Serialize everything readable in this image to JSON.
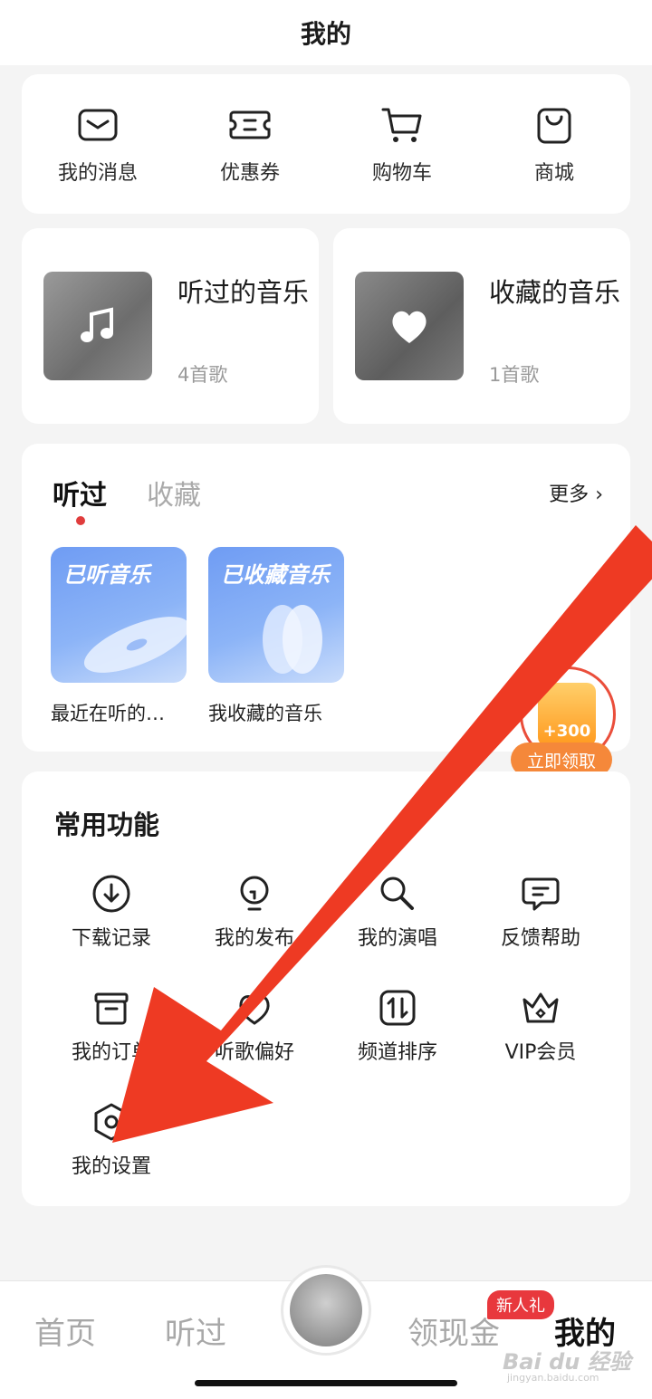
{
  "header": {
    "title": "我的"
  },
  "quick": [
    {
      "label": "我的消息",
      "icon": "message-icon"
    },
    {
      "label": "优惠券",
      "icon": "coupon-icon"
    },
    {
      "label": "购物车",
      "icon": "cart-icon"
    },
    {
      "label": "商城",
      "icon": "shopping-bag-icon"
    }
  ],
  "music_cards": {
    "listened": {
      "title": "听过的音乐",
      "count": "4首歌",
      "icon": "music-note-icon"
    },
    "collected": {
      "title": "收藏的音乐",
      "count": "1首歌",
      "icon": "heart-icon"
    }
  },
  "history": {
    "tabs": {
      "active": "听过",
      "inactive": "收藏"
    },
    "more": "更多",
    "tiles": [
      {
        "cover_text": "已听音乐",
        "label": "最近在听的…"
      },
      {
        "cover_text": "已收藏音乐",
        "label": "我收藏的音乐"
      }
    ]
  },
  "reward": {
    "amount": "+300",
    "button": "立即领取"
  },
  "functions": {
    "title": "常用功能",
    "items": [
      {
        "label": "下载记录",
        "icon": "download-icon"
      },
      {
        "label": "我的发布",
        "icon": "lightbulb-icon"
      },
      {
        "label": "我的演唱",
        "icon": "microphone-icon"
      },
      {
        "label": "反馈帮助",
        "icon": "feedback-icon"
      },
      {
        "label": "我的订单",
        "icon": "order-box-icon"
      },
      {
        "label": "听歌偏好",
        "icon": "preference-icon"
      },
      {
        "label": "频道排序",
        "icon": "sort-icon"
      },
      {
        "label": "VIP会员",
        "icon": "crown-icon"
      },
      {
        "label": "我的设置",
        "icon": "settings-icon"
      }
    ]
  },
  "nav": {
    "home": "首页",
    "listened": "听过",
    "cash": "领现金",
    "cash_badge": "新人礼",
    "mine": "我的"
  },
  "watermark": {
    "main": "Bai du 经验",
    "sub": "jingyan.baidu.com"
  },
  "colors": {
    "accent_red": "#e8383d",
    "arrow_red": "#ee3a23",
    "tile_blue": "#7aa6f5",
    "reward_orange": "#f5883a"
  }
}
